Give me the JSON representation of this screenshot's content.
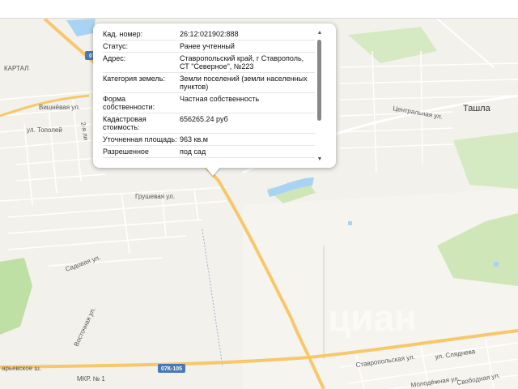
{
  "popup": {
    "rows": [
      {
        "label": "Кад. номер:",
        "value": "26:12:021902:888"
      },
      {
        "label": "Статус:",
        "value": "Ранее учтенный"
      },
      {
        "label": "Адрес:",
        "value": "Ставропольский край, г Ставрополь, СТ \"Северное\", №223"
      },
      {
        "label": "Категория земель:",
        "value": "Земли поселений (земли населенных пунктов)"
      },
      {
        "label": "Форма собственности:",
        "value": "Частная собственность"
      },
      {
        "label": "Кадастровая стоимость:",
        "value": "656265.24 руб"
      },
      {
        "label": "Уточненная площадь:",
        "value": "963 кв.м"
      },
      {
        "label": "Разрешенное",
        "value": "под сад"
      }
    ]
  },
  "map": {
    "labels": {
      "kartal": "КАРТАЛ",
      "vishnevaya": "Вишнёвая ул.",
      "topoley": "ул. Тополей",
      "grushevaya": "Грушевая ул.",
      "sadovaya": "Садовая ул.",
      "vostochnaya": "Восточная ул.",
      "tsentralnaya": "Центральная ул.",
      "tashla": "Ташла",
      "stavropolskaya": "Ставропольская ул.",
      "slyadneva": "ул. Сляднева",
      "svobodnaya": "Свободная ул.",
      "molodezhnaya": "Молодёжная ул.",
      "mkr": "МКР. № 1",
      "sh": "арьевское ш.",
      "second_line": "2-я ли",
      "road_07k105": "07К-105",
      "road_07k_top": "07К",
      "watermark": "циан"
    },
    "colors": {
      "land": "#f3f1ec",
      "highway": "#f6c86b",
      "forest": "#bfe0a4",
      "water": "#a9d3f2"
    }
  }
}
